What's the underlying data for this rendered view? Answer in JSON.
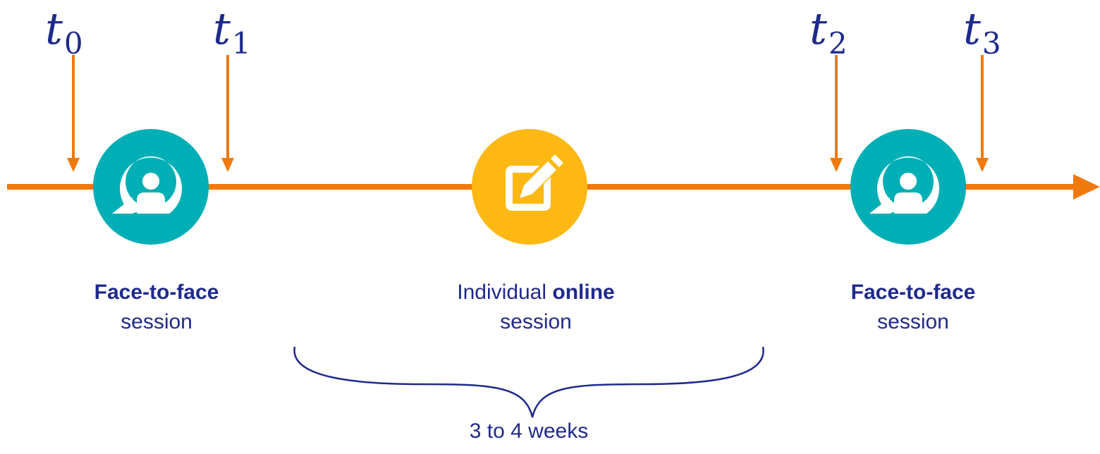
{
  "colors": {
    "timeline": "#f0790c",
    "arrow": "#f0790c",
    "face_to_face": "#00afb5",
    "online": "#fdb813",
    "text": "#1f2a8c",
    "icon": "#ffffff"
  },
  "time_markers": [
    {
      "var": "t",
      "sub": "0"
    },
    {
      "var": "t",
      "sub": "1"
    },
    {
      "var": "t",
      "sub": "2"
    },
    {
      "var": "t",
      "sub": "3"
    }
  ],
  "sessions": [
    {
      "icon": "person-chat-icon",
      "bold": "Face-to-face",
      "rest": "session"
    },
    {
      "icon": "edit-note-icon",
      "prefix": "Individual ",
      "bold": "online",
      "rest": "session"
    },
    {
      "icon": "person-chat-icon",
      "bold": "Face-to-face",
      "rest": "session"
    }
  ],
  "duration_label": "3 to 4 weeks"
}
